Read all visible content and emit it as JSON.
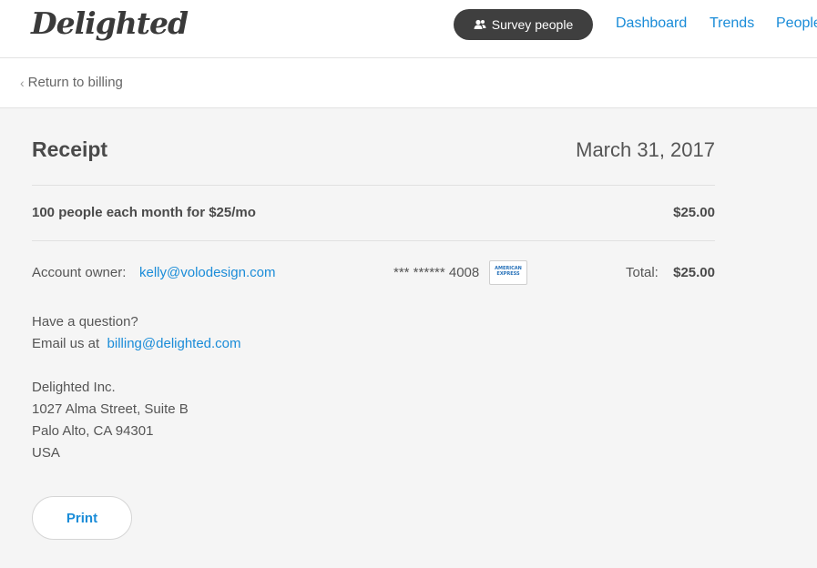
{
  "header": {
    "logo": "Delighted",
    "survey_button": {
      "label": "Survey people",
      "icon": "people-icon"
    },
    "nav": [
      {
        "label": "Dashboard"
      },
      {
        "label": "Trends"
      },
      {
        "label": "People"
      }
    ]
  },
  "subheader": {
    "back_link": "Return to billing"
  },
  "receipt": {
    "title": "Receipt",
    "date": "March 31, 2017",
    "line_item": {
      "description": "100 people each month for $25/mo",
      "amount": "$25.00"
    },
    "account_owner_label": "Account owner:",
    "account_owner_email": "kelly@volodesign.com",
    "card_number": "*** ****** 4008",
    "card_brand": {
      "name": "American Express",
      "text": "AMERICAN EXPRESS"
    },
    "total_label": "Total:",
    "total_amount": "$25.00"
  },
  "contact": {
    "question": "Have a question?",
    "email_prefix": "Email us at",
    "email": "billing@delighted.com"
  },
  "address": {
    "company": "Delighted Inc.",
    "street": "1027 Alma Street, Suite B",
    "city": "Palo Alto, CA 94301",
    "country": "USA"
  },
  "actions": {
    "print": "Print"
  },
  "colors": {
    "link": "#1a8cd8",
    "button_dark": "#3f3f3f",
    "background": "#f5f5f5"
  }
}
